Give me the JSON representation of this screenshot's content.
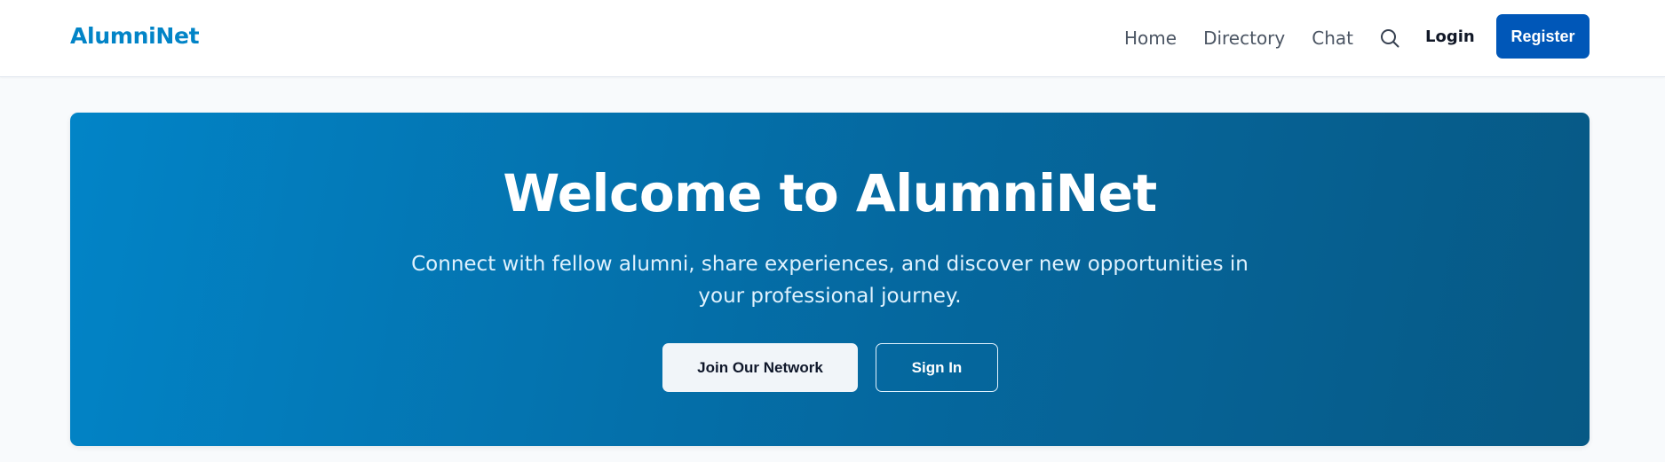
{
  "header": {
    "brand": "AlumniNet",
    "nav": {
      "home": "Home",
      "directory": "Directory",
      "chat": "Chat",
      "search_icon": "search-icon"
    },
    "login": "Login",
    "register": "Register"
  },
  "hero": {
    "title": "Welcome to AlumniNet",
    "subtitle": "Connect with fellow alumni, share experiences, and discover new opportunities in your professional journey.",
    "primary_cta": "Join Our Network",
    "secondary_cta": "Sign In"
  },
  "colors": {
    "brand": "#0284c7",
    "register_button": "#0057b8",
    "hero_gradient_start": "#0284c7",
    "hero_gradient_end": "#075985",
    "page_background": "#f8fafc"
  }
}
